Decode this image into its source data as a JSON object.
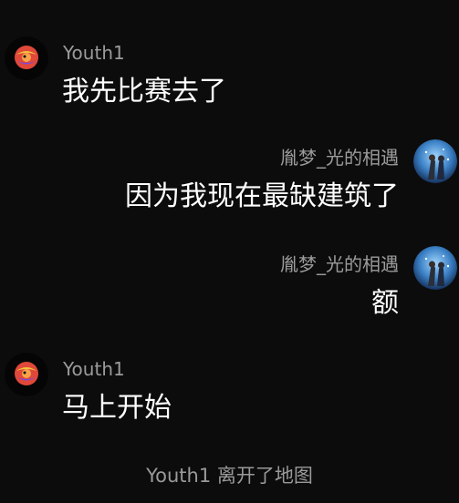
{
  "messages": [
    {
      "side": "left",
      "user": "Youth1",
      "text": "我先比赛去了",
      "avatar_icon": "youth-avatar-icon"
    },
    {
      "side": "right",
      "user": "胤梦_光的相遇",
      "text": "因为我现在最缺建筑了",
      "avatar_icon": "anime-avatar-icon"
    },
    {
      "side": "right",
      "user": "胤梦_光的相遇",
      "text": "额",
      "avatar_icon": "anime-avatar-icon"
    },
    {
      "side": "left",
      "user": "Youth1",
      "text": "马上开始",
      "avatar_icon": "youth-avatar-icon"
    }
  ],
  "system_notice": "Youth1 离开了地图",
  "colors": {
    "background": "#0c0c0c",
    "username": "#9b9b9b",
    "message_text": "#ffffff",
    "system_text": "#9a9a9a"
  }
}
